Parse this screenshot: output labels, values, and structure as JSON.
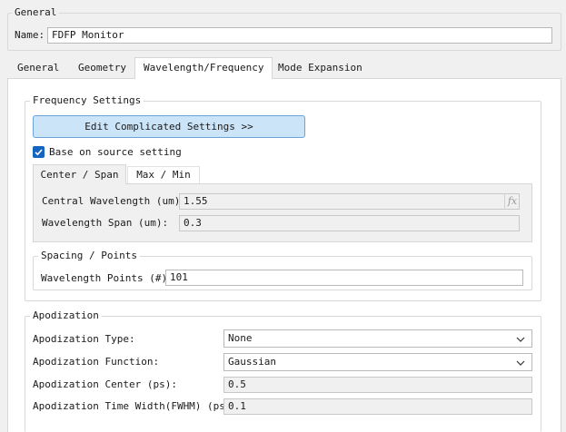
{
  "general_group": {
    "title": "General",
    "name_label": "Name:",
    "name_value": "FDFP Monitor"
  },
  "tabs": [
    {
      "label": "General",
      "active": false
    },
    {
      "label": "Geometry",
      "active": false
    },
    {
      "label": "Wavelength/Frequency",
      "active": true
    },
    {
      "label": "Mode Expansion",
      "active": false
    }
  ],
  "frequency_settings": {
    "title": "Frequency Settings",
    "edit_button": "Edit Complicated Settings >>",
    "base_on_source_label": "Base on source setting",
    "base_on_source_checked": true,
    "subtabs": [
      {
        "label": "Center / Span",
        "active": true
      },
      {
        "label": "Max / Min",
        "active": false
      }
    ],
    "central_wavelength_label": "Central Wavelength (um):",
    "central_wavelength_value": "1.55",
    "fx_icon": "fx",
    "wavelength_span_label": "Wavelength Span (um):",
    "wavelength_span_value": "0.3"
  },
  "spacing_points": {
    "title": "Spacing / Points",
    "points_label": "Wavelength Points (#):",
    "points_value": "101"
  },
  "apodization": {
    "title": "Apodization",
    "type_label": "Apodization Type:",
    "type_value": "None",
    "function_label": "Apodization Function:",
    "function_value": "Gaussian",
    "center_label": "Apodization Center (ps):",
    "center_value": "0.5",
    "width_label": "Apodization Time Width(FWHM) (ps):",
    "width_value": "0.1"
  },
  "colors": {
    "accent": "#1565c0",
    "button_bg": "#cce4f7",
    "button_border": "#6aa3d8"
  }
}
